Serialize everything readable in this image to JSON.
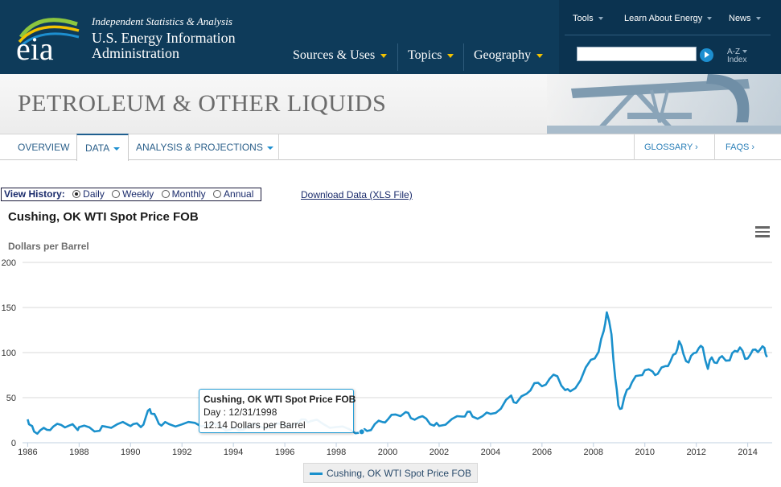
{
  "header": {
    "logo_text": "eia",
    "tagline": "Independent Statistics & Analysis",
    "org_line1": "U.S. Energy Information",
    "org_line2": "Administration",
    "main_nav": [
      "Sources & Uses",
      "Topics",
      "Geography"
    ],
    "util_nav": [
      "Tools",
      "Learn About Energy",
      "News"
    ],
    "search": {
      "value": "",
      "placeholder": ""
    },
    "az_line1": "A-Z",
    "az_line2": "Index"
  },
  "banner": {
    "title": "PETROLEUM & OTHER LIQUIDS"
  },
  "subnav": {
    "tabs": [
      "OVERVIEW",
      "DATA",
      "ANALYSIS & PROJECTIONS"
    ],
    "active_tab": "DATA",
    "right": [
      "GLOSSARY ›",
      "FAQS ›"
    ]
  },
  "controls": {
    "history_label": "View History:",
    "options": [
      "Daily",
      "Weekly",
      "Monthly",
      "Annual"
    ],
    "selected": "Daily",
    "download_link": "Download Data (XLS File)"
  },
  "chart_data": {
    "type": "line",
    "title": "Cushing, OK WTI Spot Price FOB",
    "ylabel": "Dollars per Barrel",
    "ylim": [
      0,
      200
    ],
    "yticks": [
      0,
      50,
      100,
      150,
      200
    ],
    "xticks": [
      1986,
      1988,
      1990,
      1992,
      1994,
      1996,
      1998,
      2000,
      2002,
      2004,
      2006,
      2008,
      2010,
      2012,
      2014
    ],
    "xlim": [
      1985.8,
      2014.95
    ],
    "grid": true,
    "legend_position": "bottom-center",
    "line_color": "#1a90cc",
    "series": [
      {
        "name": "Cushing, OK WTI Spot Price FOB",
        "x": [
          1986.0,
          1986.1,
          1986.25,
          1986.5,
          1986.75,
          1987.0,
          1987.3,
          1987.6,
          1987.9,
          1988.0,
          1988.4,
          1988.8,
          1989.0,
          1989.5,
          1989.9,
          1990.1,
          1990.4,
          1990.6,
          1990.75,
          1990.85,
          1991.0,
          1991.2,
          1991.5,
          1992.0,
          1992.5,
          1993.0,
          1993.5,
          1993.9,
          1994.2,
          1994.6,
          1995.0,
          1995.5,
          1996.0,
          1996.5,
          1996.8,
          1997.0,
          1997.5,
          1998.0,
          1998.5,
          1998.99,
          1999.2,
          1999.5,
          1999.8,
          2000.0,
          2000.3,
          2000.7,
          2000.9,
          2001.2,
          2001.5,
          2001.8,
          2002.0,
          2002.5,
          2002.9,
          2003.1,
          2003.3,
          2003.7,
          2004.0,
          2004.4,
          2004.8,
          2005.0,
          2005.4,
          2005.7,
          2006.0,
          2006.3,
          2006.6,
          2006.9,
          2007.1,
          2007.5,
          2007.9,
          2008.2,
          2008.4,
          2008.52,
          2008.7,
          2008.85,
          2008.97,
          2009.1,
          2009.3,
          2009.5,
          2009.8,
          2010.0,
          2010.3,
          2010.5,
          2010.8,
          2011.0,
          2011.2,
          2011.33,
          2011.5,
          2011.7,
          2011.9,
          2012.1,
          2012.25,
          2012.45,
          2012.6,
          2012.8,
          2013.0,
          2013.3,
          2013.5,
          2013.7,
          2013.9,
          2014.1,
          2014.3,
          2014.5,
          2014.65,
          2014.75
        ],
        "y": [
          26,
          20,
          12,
          13,
          15,
          18,
          19,
          20,
          16,
          17,
          16,
          14,
          18,
          20,
          21,
          21,
          17,
          28,
          38,
          32,
          27,
          20,
          21,
          20,
          21,
          20,
          18,
          14,
          15,
          19,
          18,
          18,
          20,
          22,
          25,
          25,
          21,
          17,
          14,
          12.14,
          13,
          20,
          24,
          26,
          31,
          33,
          28,
          28,
          26,
          20,
          19,
          26,
          28,
          35,
          29,
          29,
          33,
          38,
          52,
          43,
          55,
          66,
          62,
          72,
          74,
          58,
          56,
          70,
          92,
          100,
          125,
          145,
          120,
          70,
          42,
          38,
          58,
          68,
          75,
          80,
          78,
          77,
          85,
          90,
          100,
          113,
          98,
          88,
          100,
          105,
          105,
          83,
          95,
          88,
          95,
          92,
          102,
          105,
          94,
          98,
          103,
          103,
          106,
          95
        ]
      }
    ]
  },
  "tooltip": {
    "title": "Cushing, OK WTI Spot Price FOB",
    "day": "Day : 12/31/1998",
    "value": "12.14 Dollars per Barrel"
  },
  "legend": {
    "label": "Cushing, OK WTI Spot Price FOB"
  }
}
